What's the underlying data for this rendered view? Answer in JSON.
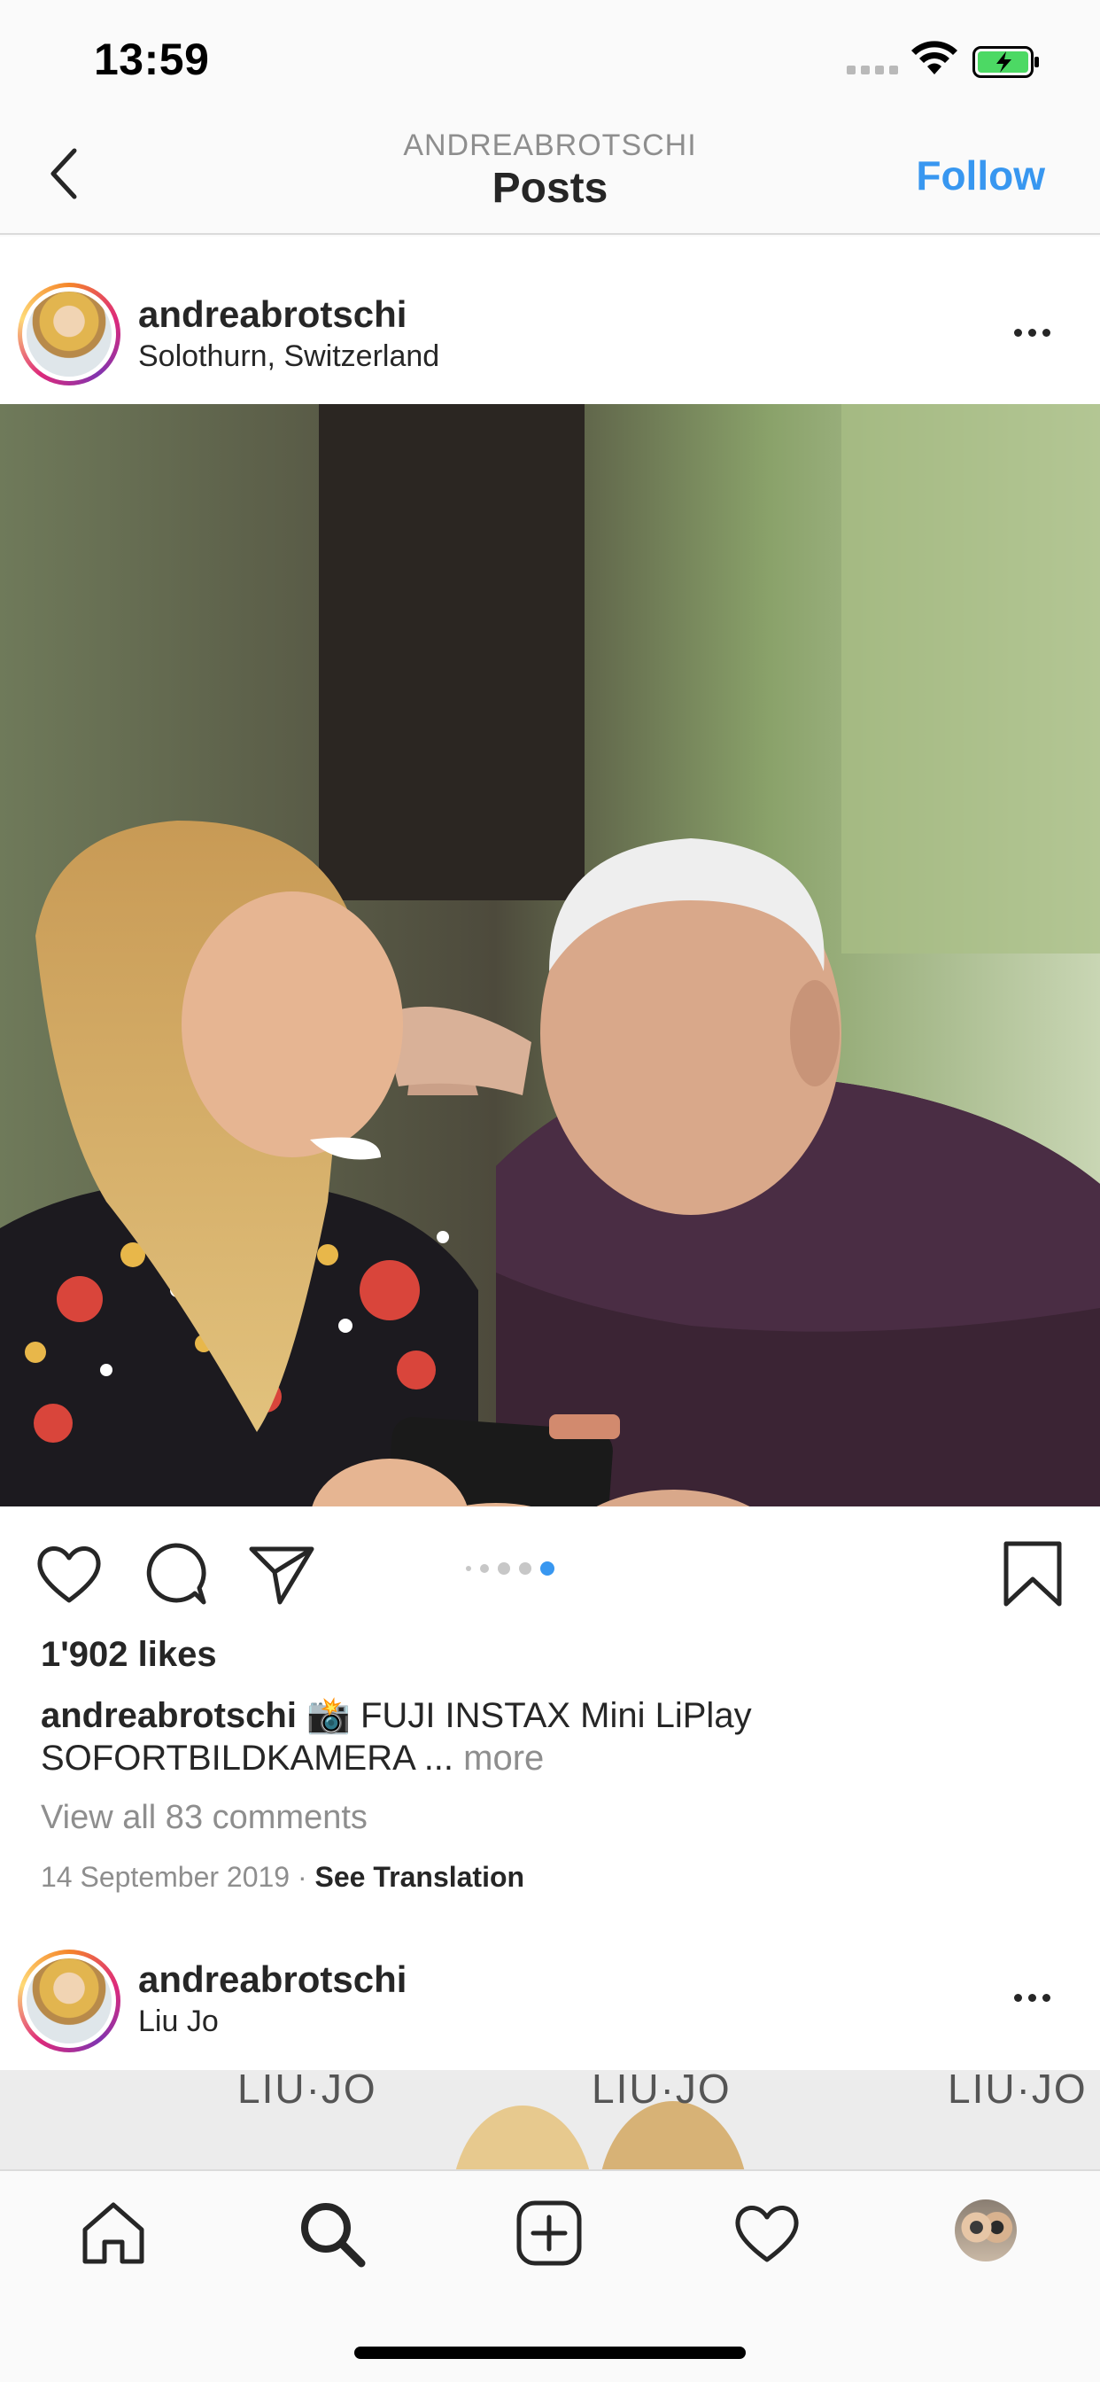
{
  "status_bar": {
    "time": "13:59",
    "icons": [
      "cellular-signal-icon",
      "wifi-icon",
      "battery-charging-icon"
    ],
    "battery_color": "#4cd964"
  },
  "nav": {
    "subtitle": "ANDREABROTSCHI",
    "title": "Posts",
    "follow_label": "Follow",
    "back_icon": "chevron-left-icon"
  },
  "colors": {
    "accent": "#3897f0",
    "text": "#262626",
    "muted": "#8e8e8e",
    "divider": "#dbdbdb"
  },
  "post": {
    "username": "andreabrotschi",
    "location": "Solothurn, Switzerland",
    "photo_description_icon": "post-photo",
    "actions": [
      "heart-icon",
      "comment-icon",
      "send-icon",
      "bookmark-icon"
    ],
    "carousel": {
      "total": 5,
      "active": 5
    },
    "likes": "1'902 likes",
    "caption_user": "andreabrotschi",
    "caption_text": " 📸 FUJI INSTAX  Mini LiPlay SOFORTBILDKAMERA ... ",
    "caption_more": "more",
    "view_comments": "View all 83 comments",
    "date": "14 September 2019",
    "date_separator": " · ",
    "see_translation": "See Translation"
  },
  "post2": {
    "username": "andreabrotschi",
    "location": "Liu Jo",
    "banner_text": [
      "LIU·JO",
      "LIU·JO",
      "LIU·JO"
    ]
  },
  "tab_bar": {
    "items": [
      "home-icon",
      "search-icon",
      "add-post-icon",
      "activity-heart-icon",
      "profile-avatar"
    ],
    "active": "search-icon"
  }
}
